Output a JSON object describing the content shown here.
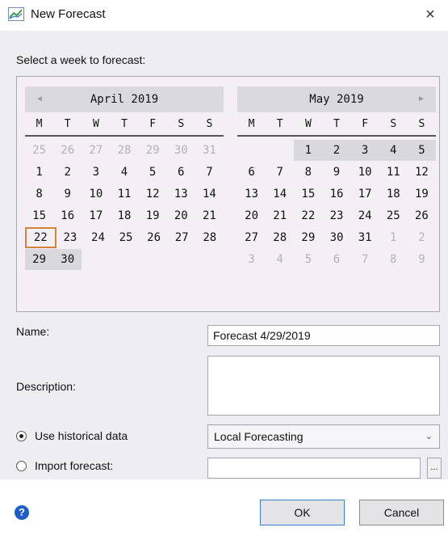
{
  "dialog": {
    "title": "New Forecast",
    "close_glyph": "×"
  },
  "prompt": "Select a week to forecast:",
  "calendar": {
    "weekdays": [
      "M",
      "T",
      "W",
      "T",
      "F",
      "S",
      "S"
    ],
    "months": [
      {
        "title": "April 2019",
        "nav": "◄",
        "weeks": [
          [
            {
              "d": "25",
              "o": true
            },
            {
              "d": "26",
              "o": true
            },
            {
              "d": "27",
              "o": true
            },
            {
              "d": "28",
              "o": true
            },
            {
              "d": "29",
              "o": true
            },
            {
              "d": "30",
              "o": true
            },
            {
              "d": "31",
              "o": true
            }
          ],
          [
            {
              "d": "1"
            },
            {
              "d": "2"
            },
            {
              "d": "3"
            },
            {
              "d": "4"
            },
            {
              "d": "5"
            },
            {
              "d": "6"
            },
            {
              "d": "7"
            }
          ],
          [
            {
              "d": "8"
            },
            {
              "d": "9"
            },
            {
              "d": "10"
            },
            {
              "d": "11"
            },
            {
              "d": "12"
            },
            {
              "d": "13"
            },
            {
              "d": "14"
            }
          ],
          [
            {
              "d": "15"
            },
            {
              "d": "16"
            },
            {
              "d": "17"
            },
            {
              "d": "18"
            },
            {
              "d": "19"
            },
            {
              "d": "20"
            },
            {
              "d": "21"
            }
          ],
          [
            {
              "d": "22",
              "t": true
            },
            {
              "d": "23"
            },
            {
              "d": "24"
            },
            {
              "d": "25"
            },
            {
              "d": "26"
            },
            {
              "d": "27"
            },
            {
              "d": "28"
            }
          ],
          [
            {
              "d": "29",
              "s": true
            },
            {
              "d": "30",
              "s": true
            },
            {
              "d": ""
            },
            {
              "d": ""
            },
            {
              "d": ""
            },
            {
              "d": ""
            },
            {
              "d": ""
            }
          ]
        ]
      },
      {
        "title": "May 2019",
        "nav": "►",
        "weeks": [
          [
            {
              "d": ""
            },
            {
              "d": ""
            },
            {
              "d": "1",
              "s": true
            },
            {
              "d": "2",
              "s": true
            },
            {
              "d": "3",
              "s": true
            },
            {
              "d": "4",
              "s": true
            },
            {
              "d": "5",
              "s": true
            }
          ],
          [
            {
              "d": "6"
            },
            {
              "d": "7"
            },
            {
              "d": "8"
            },
            {
              "d": "9"
            },
            {
              "d": "10"
            },
            {
              "d": "11"
            },
            {
              "d": "12"
            }
          ],
          [
            {
              "d": "13"
            },
            {
              "d": "14"
            },
            {
              "d": "15"
            },
            {
              "d": "16"
            },
            {
              "d": "17"
            },
            {
              "d": "18"
            },
            {
              "d": "19"
            }
          ],
          [
            {
              "d": "20"
            },
            {
              "d": "21"
            },
            {
              "d": "22"
            },
            {
              "d": "23"
            },
            {
              "d": "24"
            },
            {
              "d": "25"
            },
            {
              "d": "26"
            }
          ],
          [
            {
              "d": "27"
            },
            {
              "d": "28"
            },
            {
              "d": "29"
            },
            {
              "d": "30"
            },
            {
              "d": "31"
            },
            {
              "d": "1",
              "o": true
            },
            {
              "d": "2",
              "o": true
            }
          ],
          [
            {
              "d": "3",
              "o": true
            },
            {
              "d": "4",
              "o": true
            },
            {
              "d": "5",
              "o": true
            },
            {
              "d": "6",
              "o": true
            },
            {
              "d": "7",
              "o": true
            },
            {
              "d": "8",
              "o": true
            },
            {
              "d": "9",
              "o": true
            }
          ]
        ]
      }
    ]
  },
  "form": {
    "name_label": "Name:",
    "name_value": "Forecast 4/29/2019",
    "description_label": "Description:",
    "description_value": "",
    "historical_label": "Use historical data",
    "historical_selected": true,
    "source_value": "Local Forecasting",
    "source_chevron": "⌄",
    "import_label": "Import forecast:",
    "import_value": "",
    "browse_label": "..."
  },
  "footer": {
    "help_glyph": "?",
    "ok_label": "OK",
    "cancel_label": "Cancel"
  },
  "colors": {
    "today_border": "#d4833a",
    "selected_week": "#d8d8dd",
    "help_icon": "#1e5cc8"
  }
}
